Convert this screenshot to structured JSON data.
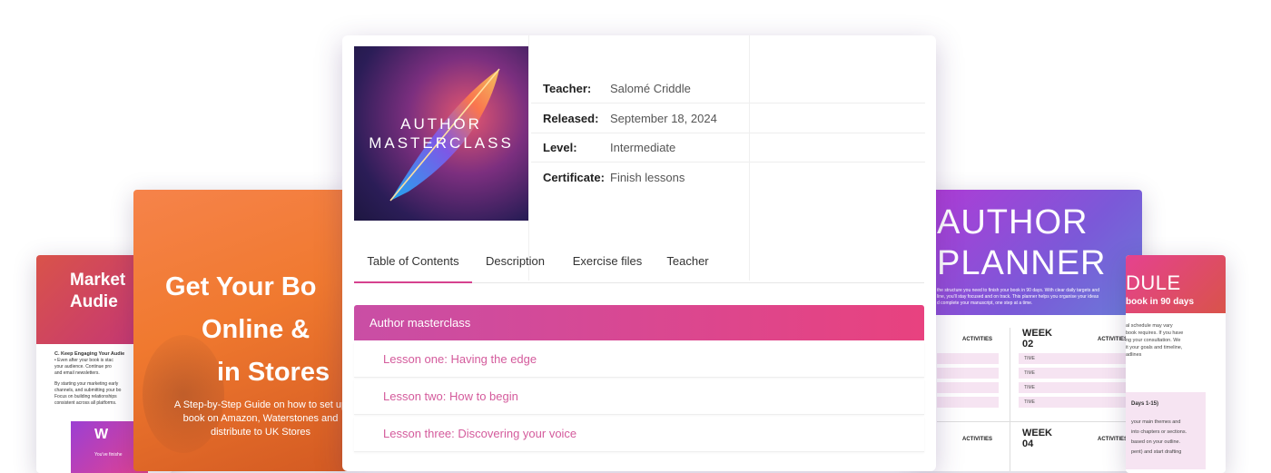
{
  "main": {
    "cover": {
      "line1": "AUTHOR",
      "line2": "MASTERCLASS"
    },
    "meta": [
      {
        "key": "Teacher:",
        "value": "Salomé Criddle"
      },
      {
        "key": "Released:",
        "value": "September 18, 2024"
      },
      {
        "key": "Level:",
        "value": "Intermediate"
      },
      {
        "key": "Certificate:",
        "value": "Finish lessons"
      }
    ],
    "tabs": [
      "Table of Contents",
      "Description",
      "Exercise files",
      "Teacher"
    ],
    "toc": {
      "section": "Author masterclass",
      "lessons": [
        "Lesson one: Having the edge",
        "Lesson two: How to begin",
        "Lesson three: Discovering your voice"
      ]
    }
  },
  "doc_left": {
    "title_l1": "Market",
    "title_l2": "Audie",
    "heading": "C. Keep Engaging Your Audie",
    "bullet": "• Even after your book is stac",
    "p1": "your audience. Continue pro",
    "p2": "and email newsletters.",
    "p3": "By starting your marketing early",
    "p4": "channels, and submitting your bo",
    "p5": "Focus on building relationships",
    "p6": "consistent across all platforms.",
    "banner": "W",
    "banner_sub": "You've finishe"
  },
  "doc_orange": {
    "title_l1": "Get Your Bo",
    "title_l2": "Online &",
    "title_l3": "in Stores",
    "sub_l1": "A Step-by-Step Guide on how to set up",
    "sub_l2": "book on Amazon, Waterstones and",
    "sub_l3": "distribute to UK Stores"
  },
  "doc_planner": {
    "title_l1": "AUTHOR",
    "title_l2": "PLANNER",
    "desc_l1": "the structure you need to finish your book in 90 days. With clear daily targets and",
    "desc_l2": "line, you'll stay focused and on track. This planner helps you organise your ideas",
    "desc_l3": "d complete your manuscript, one step at a time.",
    "activities": "ACTIVITIES",
    "week_label": "WEEK",
    "week_a": "02",
    "week_b": "04",
    "time": "TIME"
  },
  "doc_sched": {
    "title": "DULE",
    "subtitle": "book in 90 days",
    "p_l1": "al schedule may vary",
    "p_l2": "book requires. If you have",
    "p_l3": "ng your consultation. We",
    "p_l4": "it your goals and timeline,",
    "p_l5": "adlines",
    "box_title": "Days 1-15)",
    "box_l1": "your main themes and",
    "box_l2": "into chapters or sections.",
    "box_l3": "based on your outline.",
    "box_l4": "pent) and start drafting"
  }
}
